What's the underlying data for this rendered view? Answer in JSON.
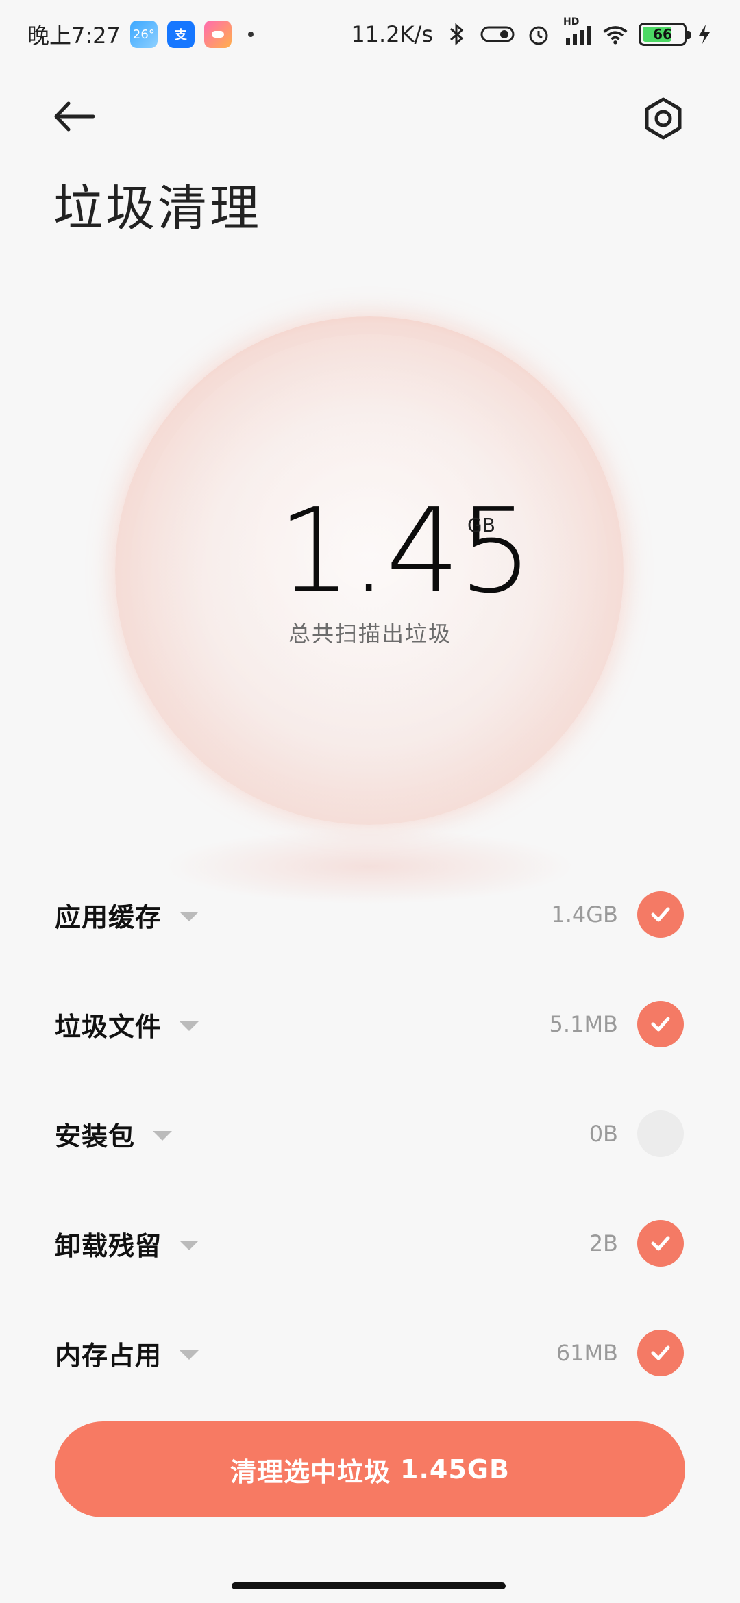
{
  "status_bar": {
    "time": "晚上7:27",
    "weather_badge": "26°",
    "alipay_badge": "支",
    "net_speed": "11.2K/s",
    "network_badge": "HD",
    "battery": "66",
    "icons": [
      "weather-icon",
      "alipay-icon",
      "game-icon",
      "bluetooth-icon",
      "toggle-icon",
      "alarm-icon",
      "signal-icon",
      "wifi-icon",
      "battery-icon",
      "charging-icon"
    ]
  },
  "header": {
    "title": "垃圾清理",
    "back_icon": "back-arrow-icon",
    "settings_icon": "settings-icon"
  },
  "summary": {
    "value": "1.45",
    "unit": "GB",
    "caption": "总共扫描出垃圾"
  },
  "items": [
    {
      "label": "应用缓存",
      "size": "1.4GB",
      "checked": true
    },
    {
      "label": "垃圾文件",
      "size": "5.1MB",
      "checked": true
    },
    {
      "label": "安装包",
      "size": "0B",
      "checked": false
    },
    {
      "label": "卸载残留",
      "size": "2B",
      "checked": true
    },
    {
      "label": "内存占用",
      "size": "61MB",
      "checked": true
    }
  ],
  "action": {
    "label": "清理选中垃圾",
    "size": "1.45GB"
  },
  "colors": {
    "accent": "#f77a63",
    "check_on": "#f47a65",
    "check_off": "#ececec",
    "background": "#f7f7f7"
  }
}
